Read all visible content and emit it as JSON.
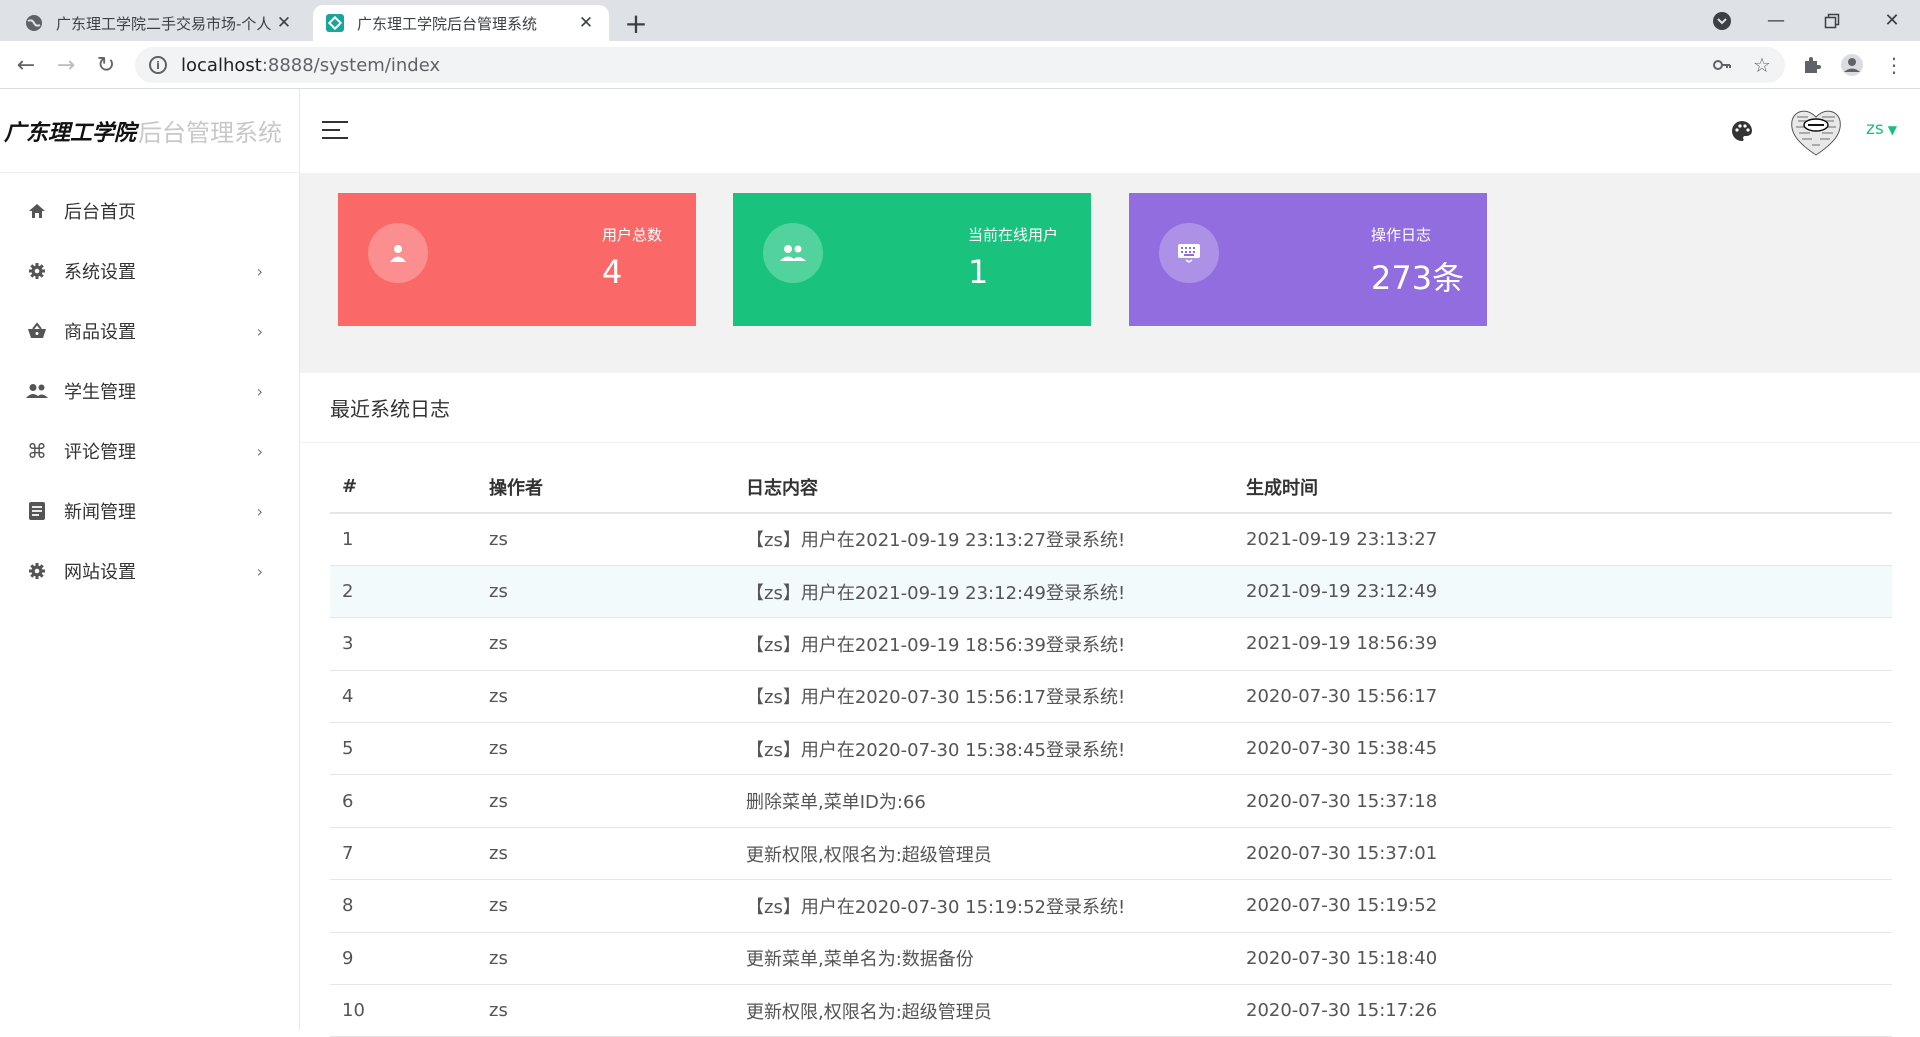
{
  "browser": {
    "tabs": [
      {
        "title": "广东理工学院二手交易市场-个人",
        "active": false
      },
      {
        "title": "广东理工学院后台管理系统",
        "active": true
      }
    ],
    "url_host": "localhost",
    "url_path": ":8888/system/index"
  },
  "logo": {
    "brand": "广东理工学院",
    "suffix": "后台管理系统"
  },
  "sidebar": {
    "items": [
      {
        "label": "后台首页",
        "icon": "home-icon",
        "has_arrow": false
      },
      {
        "label": "系统设置",
        "icon": "gear-icon",
        "has_arrow": true
      },
      {
        "label": "商品设置",
        "icon": "basket-icon",
        "has_arrow": true
      },
      {
        "label": "学生管理",
        "icon": "users-icon",
        "has_arrow": true
      },
      {
        "label": "评论管理",
        "icon": "command-icon",
        "has_arrow": true
      },
      {
        "label": "新闻管理",
        "icon": "news-icon",
        "has_arrow": true
      },
      {
        "label": "网站设置",
        "icon": "gear-icon",
        "has_arrow": true
      }
    ]
  },
  "header": {
    "username": "zs"
  },
  "cards": [
    {
      "label": "用户总数",
      "value": "4",
      "color": "#fa6868",
      "icon": "user-icon"
    },
    {
      "label": "当前在线用户",
      "value": "1",
      "color": "#19c37d",
      "icon": "group-icon"
    },
    {
      "label": "操作日志",
      "value": "273条",
      "color": "#916ddf",
      "icon": "keyboard-icon"
    }
  ],
  "log_panel": {
    "title": "最近系统日志",
    "columns": [
      "#",
      "操作者",
      "日志内容",
      "生成时间"
    ],
    "rows": [
      [
        "1",
        "zs",
        "【zs】用户在2021-09-19 23:13:27登录系统!",
        "2021-09-19 23:13:27"
      ],
      [
        "2",
        "zs",
        "【zs】用户在2021-09-19 23:12:49登录系统!",
        "2021-09-19 23:12:49"
      ],
      [
        "3",
        "zs",
        "【zs】用户在2021-09-19 18:56:39登录系统!",
        "2021-09-19 18:56:39"
      ],
      [
        "4",
        "zs",
        "【zs】用户在2020-07-30 15:56:17登录系统!",
        "2020-07-30 15:56:17"
      ],
      [
        "5",
        "zs",
        "【zs】用户在2020-07-30 15:38:45登录系统!",
        "2020-07-30 15:38:45"
      ],
      [
        "6",
        "zs",
        "删除菜单,菜单ID为:66",
        "2020-07-30 15:37:18"
      ],
      [
        "7",
        "zs",
        "更新权限,权限名为:超级管理员",
        "2020-07-30 15:37:01"
      ],
      [
        "8",
        "zs",
        "【zs】用户在2020-07-30 15:19:52登录系统!",
        "2020-07-30 15:19:52"
      ],
      [
        "9",
        "zs",
        "更新菜单,菜单名为:数据备份",
        "2020-07-30 15:18:40"
      ],
      [
        "10",
        "zs",
        "更新权限,权限名为:超级管理员",
        "2020-07-30 15:17:26"
      ]
    ]
  }
}
